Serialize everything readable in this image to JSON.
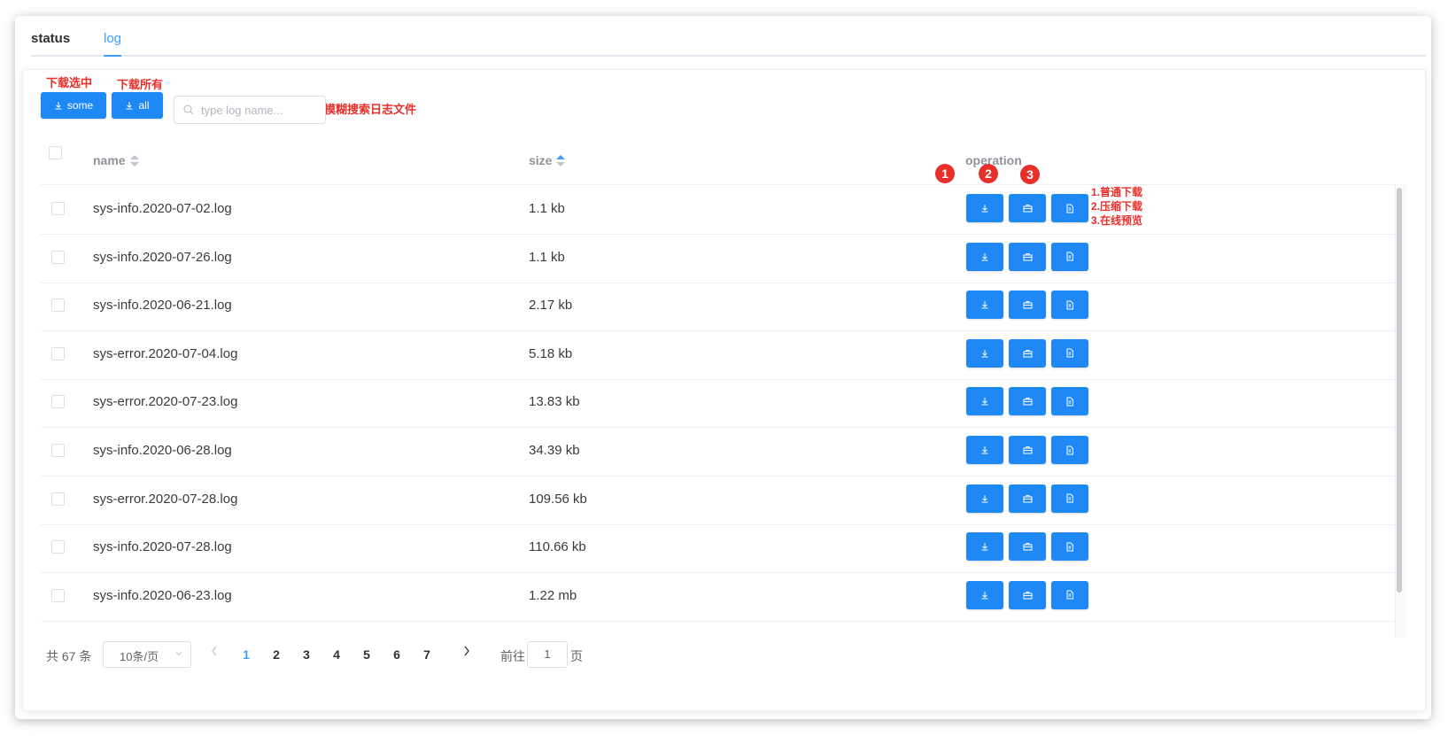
{
  "tabs": [
    {
      "label": "status"
    },
    {
      "label": "log"
    }
  ],
  "annotations": {
    "download_selected": "下载选中",
    "download_all": "下载所有",
    "fuzzy_search": "模糊搜索日志文件",
    "badge_1": "1",
    "badge_2": "2",
    "badge_3": "3",
    "legend_1": "1.普通下载",
    "legend_2": "2.压缩下载",
    "legend_3": "3.在线预览"
  },
  "toolbar": {
    "some_label": "some",
    "all_label": "all",
    "search_placeholder": "type log name..."
  },
  "table": {
    "columns": {
      "name": "name",
      "size": "size",
      "operation": "operation"
    },
    "sort_active_column": "size",
    "rows": [
      {
        "name": "sys-info.2020-07-02.log",
        "size": "1.1 kb"
      },
      {
        "name": "sys-info.2020-07-26.log",
        "size": "1.1 kb"
      },
      {
        "name": "sys-info.2020-06-21.log",
        "size": "2.17 kb"
      },
      {
        "name": "sys-error.2020-07-04.log",
        "size": "5.18 kb"
      },
      {
        "name": "sys-error.2020-07-23.log",
        "size": "13.83 kb"
      },
      {
        "name": "sys-info.2020-06-28.log",
        "size": "34.39 kb"
      },
      {
        "name": "sys-error.2020-07-28.log",
        "size": "109.56 kb"
      },
      {
        "name": "sys-info.2020-07-28.log",
        "size": "110.66 kb"
      },
      {
        "name": "sys-info.2020-06-23.log",
        "size": "1.22 mb"
      }
    ]
  },
  "pagination": {
    "total": "共 67 条",
    "page_size": "10条/页",
    "pages": [
      "1",
      "2",
      "3",
      "4",
      "5",
      "6",
      "7"
    ],
    "current_page": "1",
    "goto_label": "前往",
    "goto_value": "1",
    "page_unit": "页"
  },
  "colors": {
    "primary": "#409eff",
    "button": "#1e88f5",
    "annotation": "#e8302b"
  },
  "icons": {
    "download": "download-icon",
    "zip": "briefcase-icon",
    "preview": "document-icon"
  }
}
